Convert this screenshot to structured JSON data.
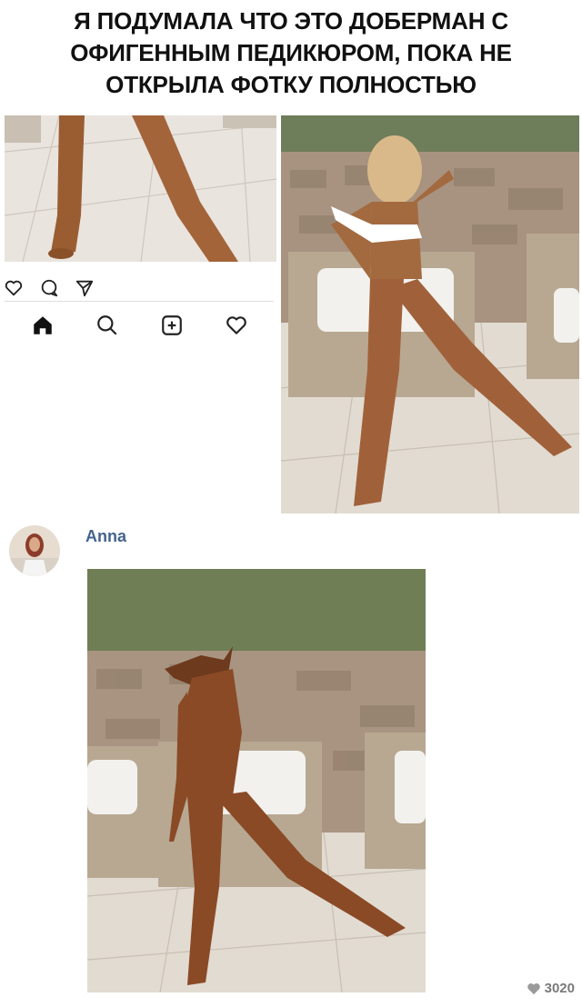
{
  "meme": {
    "caption_lines": [
      "Я ПОДУМАЛА ЧТО ЭТО ДОБЕРМАН С",
      "ОФИГЕННЫМ ПЕДИКЮРОМ, ПОКА НЕ",
      "ОТКРЫЛА ФОТКУ ПОЛНОСТЬЮ"
    ]
  },
  "instagram_crop": {
    "actions": [
      "heart-icon",
      "comment-icon",
      "share-icon"
    ],
    "nav_icons": [
      "home-icon",
      "search-icon",
      "add-post-icon",
      "activity-heart-icon"
    ],
    "colors": {
      "icon": "#222222",
      "divider": "#dedede"
    }
  },
  "post": {
    "username": "Anna",
    "likes_count": "3020",
    "colors": {
      "username": "#43648c",
      "likes": "#7a7a7a"
    }
  }
}
